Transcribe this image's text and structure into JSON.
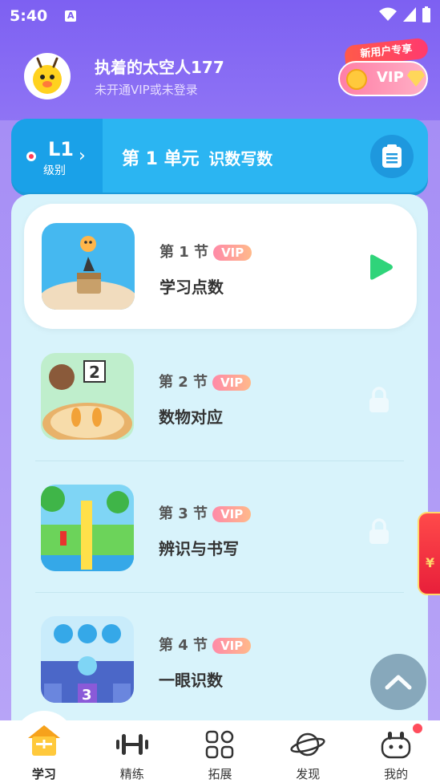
{
  "status": {
    "time": "5:40",
    "a_icon": "A"
  },
  "header": {
    "user_name": "执着的太空人177",
    "user_sub": "未开通VIP或未登录",
    "vip_tag": "新用户专享",
    "vip_label": "VIP"
  },
  "unit": {
    "level_code": "L1",
    "level_label": "级别",
    "title": "第 1 单元",
    "subtitle": "识数写数"
  },
  "lessons": [
    {
      "num": "第 1 节",
      "vip": "VIP",
      "title": "学习点数",
      "state": "play"
    },
    {
      "num": "第 2 节",
      "vip": "VIP",
      "title": "数物对应",
      "state": "locked"
    },
    {
      "num": "第 3 节",
      "vip": "VIP",
      "title": "辨识与书写",
      "state": "locked"
    },
    {
      "num": "第 4 节",
      "vip": "VIP",
      "title": "一眼识数",
      "state": "locked"
    }
  ],
  "side_packet": {
    "symbol": "¥"
  },
  "nav": [
    {
      "label": "学习",
      "icon": "house-icon",
      "active": true
    },
    {
      "label": "精练",
      "icon": "dumbbell-icon"
    },
    {
      "label": "拓展",
      "icon": "grid-icon"
    },
    {
      "label": "发现",
      "icon": "planet-icon"
    },
    {
      "label": "我的",
      "icon": "robot-face-icon"
    }
  ],
  "colors": {
    "accent": "#7d60f2",
    "unit_bar": "#2bb5f2",
    "play": "#2fd47a"
  }
}
